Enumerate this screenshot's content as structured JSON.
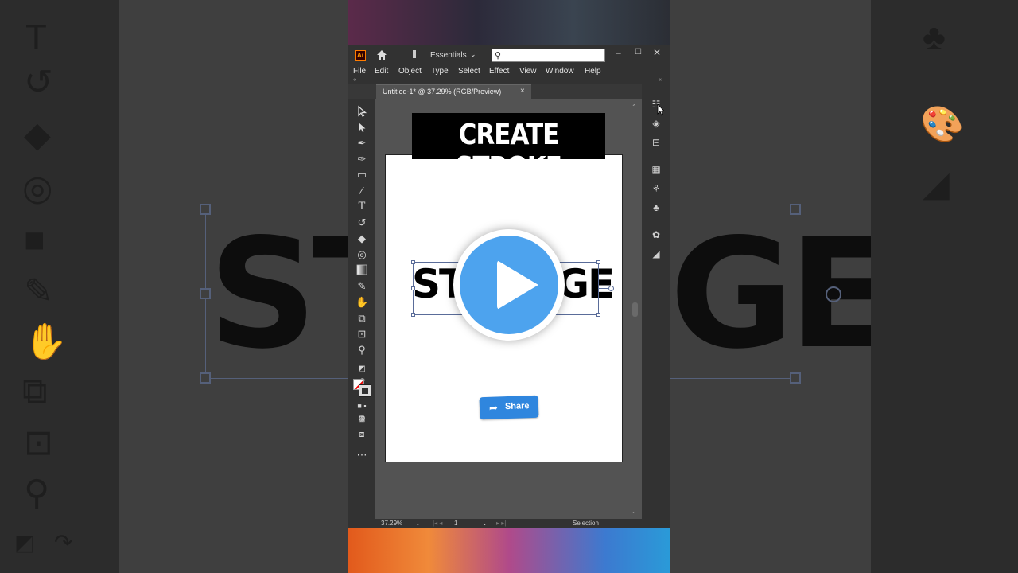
{
  "app": {
    "logo_text": "Ai",
    "workspace_label": "Essentials",
    "search": {
      "value": "",
      "placeholder": ""
    }
  },
  "menubar": {
    "items": [
      "File",
      "Edit",
      "Object",
      "Type",
      "Select",
      "Effect",
      "View",
      "Window",
      "Help"
    ]
  },
  "document": {
    "tab_title": "Untitled-1* @ 37.29% (RGB/Preview)",
    "close_glyph": "×"
  },
  "statusbar": {
    "zoom": "37.29%",
    "artboard_number": "1",
    "tool_name": "Selection"
  },
  "overlay": {
    "title": "CREATE STROKE",
    "artwork_left": "ST",
    "artwork_right": "GE",
    "background_left_text": "ST",
    "background_right_text": "GE",
    "share_label": "Share"
  },
  "icons": {
    "toolbar": [
      "selection-icon",
      "direct-selection-icon",
      "pen-icon",
      "curvature-icon",
      "rectangle-icon",
      "paintbrush-icon",
      "type-icon",
      "rotate-icon",
      "eraser-icon",
      "shape-builder-icon",
      "gradient-icon",
      "eyedropper-icon",
      "puppet-warp-icon",
      "blend-icon",
      "artboard-icon",
      "zoom-icon",
      "swap-colors-icon",
      "fill-stroke-icon",
      "color-mode-icon",
      "draw-mode-icon",
      "screen-mode-icon",
      "more-tools-icon"
    ],
    "right_panel": [
      "properties-icon",
      "layers-icon",
      "libraries-icon",
      "align-icon",
      "symbols-icon",
      "club-icon",
      "brushes-icon",
      "gradient-panel-icon"
    ]
  },
  "colors": {
    "ui_dark": "#323232",
    "canvas": "#535353",
    "play_blue": "#4da3ee",
    "share_blue": "#2f86de",
    "ai_orange": "#ff9a00"
  }
}
